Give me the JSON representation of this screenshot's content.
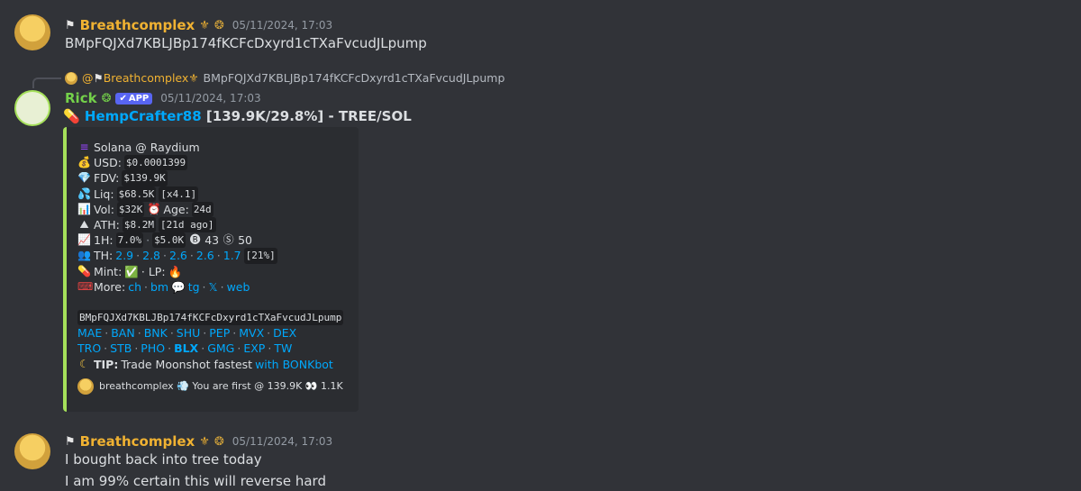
{
  "messages": [
    {
      "username": "Breathcomplex",
      "timestamp": "05/11/2024, 17:03",
      "lines": [
        "BMpFQJXd7KBLJBp174fKCFcDxyrd1cTXaFvcudJLpump"
      ]
    },
    {
      "reply": {
        "mention": "@",
        "username": "Breathcomplex",
        "text": "BMpFQJXd7KBLJBp174fKCFcDxyrd1cTXaFvcudJLpump"
      },
      "username": "Rick",
      "app_badge": "APP",
      "timestamp": "05/11/2024, 17:03",
      "headline": {
        "token_link": "HempCrafter88",
        "stats": "[139.9K/29.8%] - TREE/SOL"
      },
      "embed": {
        "chain": "Solana @ Raydium",
        "usd_label": "USD:",
        "usd_value": "$0.0001399",
        "fdv_label": "FDV:",
        "fdv_value": "$139.9K",
        "liq_label": "Liq:",
        "liq_value": "$68.5K",
        "liq_mult": "[x4.1]",
        "vol_label": "Vol:",
        "vol_value": "$32K",
        "age_label": "Age:",
        "age_value": "24d",
        "ath_label": "ATH:",
        "ath_value": "$8.2M",
        "ath_ago": "[21d ago]",
        "h1_label": "1H:",
        "h1_pct": "7.0%",
        "h1_sep": "·",
        "h1_vol": "$5.0K",
        "h1_buys": "43",
        "h1_sells": "50",
        "th_label": "TH:",
        "th_values": [
          "2.9",
          "2.8",
          "2.6",
          "2.6",
          "1.7"
        ],
        "th_total": "[21%]",
        "mint_label": "Mint:",
        "mint_value": "✅",
        "lp_label": "· LP:",
        "lp_value": "🔥",
        "more_label": "More:",
        "more_links": [
          "ch",
          "bm",
          "tg",
          "𝕏",
          "web"
        ],
        "address": "BMpFQJXd7KBLJBp174fKCFcDxyrd1cTXaFvcudJLpump",
        "links_row1": [
          "MAE",
          "BAN",
          "BNK",
          "SHU",
          "PEP",
          "MVX",
          "DEX"
        ],
        "links_row2": [
          "TRO",
          "STB",
          "PHO",
          "BLX",
          "GMG",
          "EXP",
          "TW"
        ],
        "tip_label": "TIP:",
        "tip_text": "Trade Moonshot fastest",
        "tip_link": "with BONKbot",
        "footer": "breathcomplex 💨 You are first @ 139.9K 👀 1.1K"
      }
    },
    {
      "username": "Breathcomplex",
      "timestamp": "05/11/2024, 17:03",
      "lines": [
        "I bought back into tree today",
        "I am 99% certain this will reverse hard"
      ]
    }
  ],
  "icons": {
    "chain": "solana-icon",
    "usd": "money-bag-icon",
    "fdv": "diamond-icon",
    "liq": "droplets-icon",
    "vol": "bar-chart-icon",
    "age": "clock-icon",
    "ath": "mountain-icon",
    "h1": "trend-up-icon",
    "th": "people-icon",
    "mint": "pill-icon",
    "more": "keyboard-icon",
    "tip": "moon-icon"
  },
  "colors": {
    "orange_name": "#f0b232",
    "green_name": "#74d14a",
    "link": "#00a8fc",
    "embed_accent": "#a5e05a",
    "app_badge": "#5865f2"
  }
}
